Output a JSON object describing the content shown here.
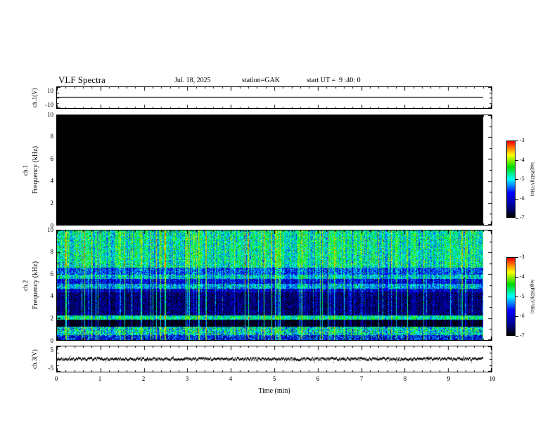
{
  "header": {
    "title": "VLF Spectra",
    "date": "Jul. 18, 2025",
    "station": "station=GAK",
    "start_ut": "start UT =  9 :40: 0"
  },
  "chart_data": {
    "type": "heatmap",
    "title": "VLF Spectra",
    "x": {
      "label": "Time (min)",
      "min": 0,
      "max": 10,
      "major_ticks": [
        0,
        1,
        2,
        3,
        4,
        5,
        6,
        7,
        8,
        9,
        10
      ],
      "minor_step": 0.2,
      "data_end": 9.8
    },
    "colormap": {
      "vmin": -7,
      "vmax": -3,
      "stops": [
        {
          "t": 0.0,
          "color": "#000000"
        },
        {
          "t": 0.13,
          "color": "#00008b"
        },
        {
          "t": 0.32,
          "color": "#0000ff"
        },
        {
          "t": 0.5,
          "color": "#00ffff"
        },
        {
          "t": 0.66,
          "color": "#00dd00"
        },
        {
          "t": 0.82,
          "color": "#ffff00"
        },
        {
          "t": 0.93,
          "color": "#ff6600"
        },
        {
          "t": 1.0,
          "color": "#ff0000"
        }
      ]
    },
    "colorbars": [
      {
        "label": "log(PSD)(V²/Hz)",
        "ticks": [
          -3,
          -4,
          -5,
          -6,
          -7
        ]
      },
      {
        "label": "log(PSD)(V²/Hz)",
        "ticks": [
          -3,
          -4,
          -5,
          -6,
          -7
        ]
      }
    ],
    "panels": [
      {
        "id": "ch1-voltage",
        "kind": "line",
        "ylabel": "ch.1(V)",
        "ymin": -10,
        "ymax": 10,
        "yticks": [
          10,
          -10
        ],
        "seed": 3,
        "trace": {
          "shape": "constant",
          "value_v": 0,
          "noise_v": 0.05
        }
      },
      {
        "id": "ch1-spectrogram",
        "kind": "spectrogram",
        "channel_label": "ch.1",
        "ylabel": "Frequency (kHz)",
        "ymin": 0,
        "ymax": 10,
        "yticks": [
          0,
          2,
          4,
          6,
          8,
          10
        ],
        "seed": 101,
        "bands": [
          {
            "f": [
              0,
              10
            ],
            "level": -7.3,
            "noise": 0.05,
            "bright": false
          }
        ],
        "streaks": {
          "density": 0,
          "max_boost": 0
        },
        "note": "no signal above noise floor - panel appears solid black at/below -7"
      },
      {
        "id": "ch2-spectrogram",
        "kind": "spectrogram",
        "channel_label": "ch.2",
        "ylabel": "Frequency (kHz)",
        "ymin": 0,
        "ymax": 10,
        "yticks": [
          0,
          2,
          4,
          6,
          8,
          10
        ],
        "seed": 7,
        "bands": [
          {
            "f": [
              6.6,
              10
            ],
            "level": -4.8,
            "noise": 0.65,
            "bright": true
          },
          {
            "f": [
              6.0,
              6.6
            ],
            "level": -5.6,
            "noise": 0.75,
            "bright": true
          },
          {
            "f": [
              5.55,
              6.0
            ],
            "level": -5.05,
            "noise": 0.6,
            "bright": true
          },
          {
            "f": [
              5.15,
              5.55
            ],
            "level": -6.0,
            "noise": 0.7,
            "bright": false
          },
          {
            "f": [
              4.7,
              5.15
            ],
            "level": -5.2,
            "noise": 0.6,
            "bright": true
          },
          {
            "f": [
              4.35,
              4.7
            ],
            "level": -6.15,
            "noise": 0.7,
            "bright": false
          },
          {
            "f": [
              2.25,
              4.35
            ],
            "level": -6.55,
            "noise": 0.55,
            "bright": false
          },
          {
            "f": [
              1.85,
              2.25
            ],
            "level": -4.8,
            "noise": 0.5,
            "bright": true
          },
          {
            "f": [
              1.2,
              1.85
            ],
            "level": -6.95,
            "noise": 0.25,
            "bright": false
          },
          {
            "f": [
              0.45,
              1.2
            ],
            "level": -4.95,
            "noise": 0.8,
            "bright": true
          },
          {
            "f": [
              0,
              0.45
            ],
            "level": -5.9,
            "noise": 0.9,
            "bright": false
          }
        ],
        "streaks": {
          "density": 0.16,
          "max_boost": 2.1
        },
        "note": "broadband VLF noise with vertical sferic streaks, bright bands near 0.5-1.2, 2, 4.7-6 and 6.6-10 kHz, dark gap 1.2-1.85 kHz"
      },
      {
        "id": "ch3-voltage",
        "kind": "line",
        "ylabel": "ch.3(V)",
        "ymin": -5,
        "ymax": 5,
        "yticks": [
          5,
          -5
        ],
        "seed": 9,
        "trace": {
          "shape": "noisy",
          "value_v": 0,
          "noise_v": 0.5
        }
      }
    ]
  }
}
